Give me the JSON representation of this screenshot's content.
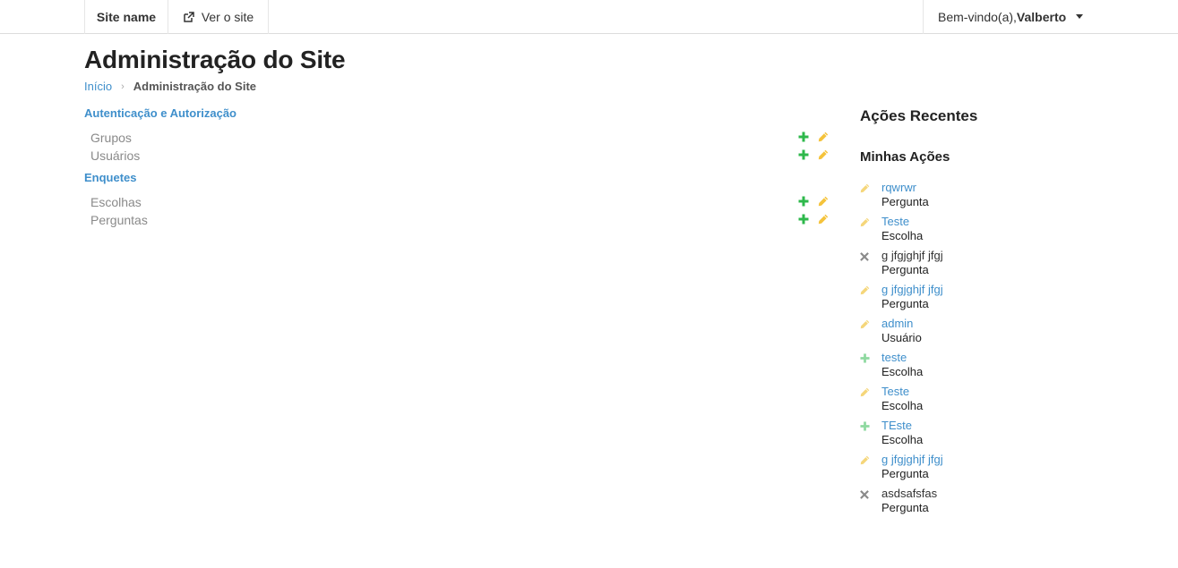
{
  "navbar": {
    "site_name": "Site name",
    "view_site": "Ver o site",
    "welcome": "Bem-vindo(a),",
    "username": "Valberto"
  },
  "page": {
    "title": "Administração do Site",
    "breadcrumb": {
      "home": "Início",
      "current": "Administração do Site"
    }
  },
  "modules": [
    {
      "title": "Autenticação e Autorização",
      "models": [
        "Grupos",
        "Usuários"
      ]
    },
    {
      "title": "Enquetes",
      "models": [
        "Escolhas",
        "Perguntas"
      ]
    }
  ],
  "recent": {
    "title": "Ações Recentes",
    "my_actions_title": "Minhas Ações",
    "items": [
      {
        "action": "change",
        "name": "rqwrwr",
        "type": "Pergunta"
      },
      {
        "action": "change",
        "name": "Teste",
        "type": "Escolha"
      },
      {
        "action": "delete",
        "name": "g jfgjghjf jfgj",
        "type": "Pergunta"
      },
      {
        "action": "change",
        "name": "g jfgjghjf jfgj",
        "type": "Pergunta"
      },
      {
        "action": "change",
        "name": "admin",
        "type": "Usuário"
      },
      {
        "action": "add",
        "name": "teste",
        "type": "Escolha"
      },
      {
        "action": "change",
        "name": "Teste",
        "type": "Escolha"
      },
      {
        "action": "add",
        "name": "TEste",
        "type": "Escolha"
      },
      {
        "action": "change",
        "name": "g jfgjghjf jfgj",
        "type": "Pergunta"
      },
      {
        "action": "delete",
        "name": "asdsafsfas",
        "type": "Pergunta"
      }
    ]
  },
  "colors": {
    "link": "#3f8fcb",
    "add": "#2eb84b",
    "change": "#f5c33b",
    "delete": "#8a8a8a"
  }
}
